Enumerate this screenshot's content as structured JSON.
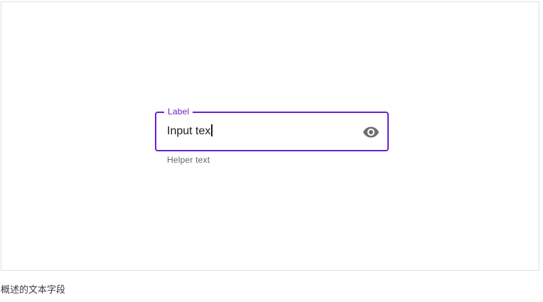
{
  "text_field": {
    "label": "Label",
    "value": "Input tex",
    "helper_text": "Helper text",
    "trailing_icon": "eye-icon",
    "accent_color": "#6a1fd1",
    "state": "focused"
  },
  "caption": "概述的文本字段"
}
